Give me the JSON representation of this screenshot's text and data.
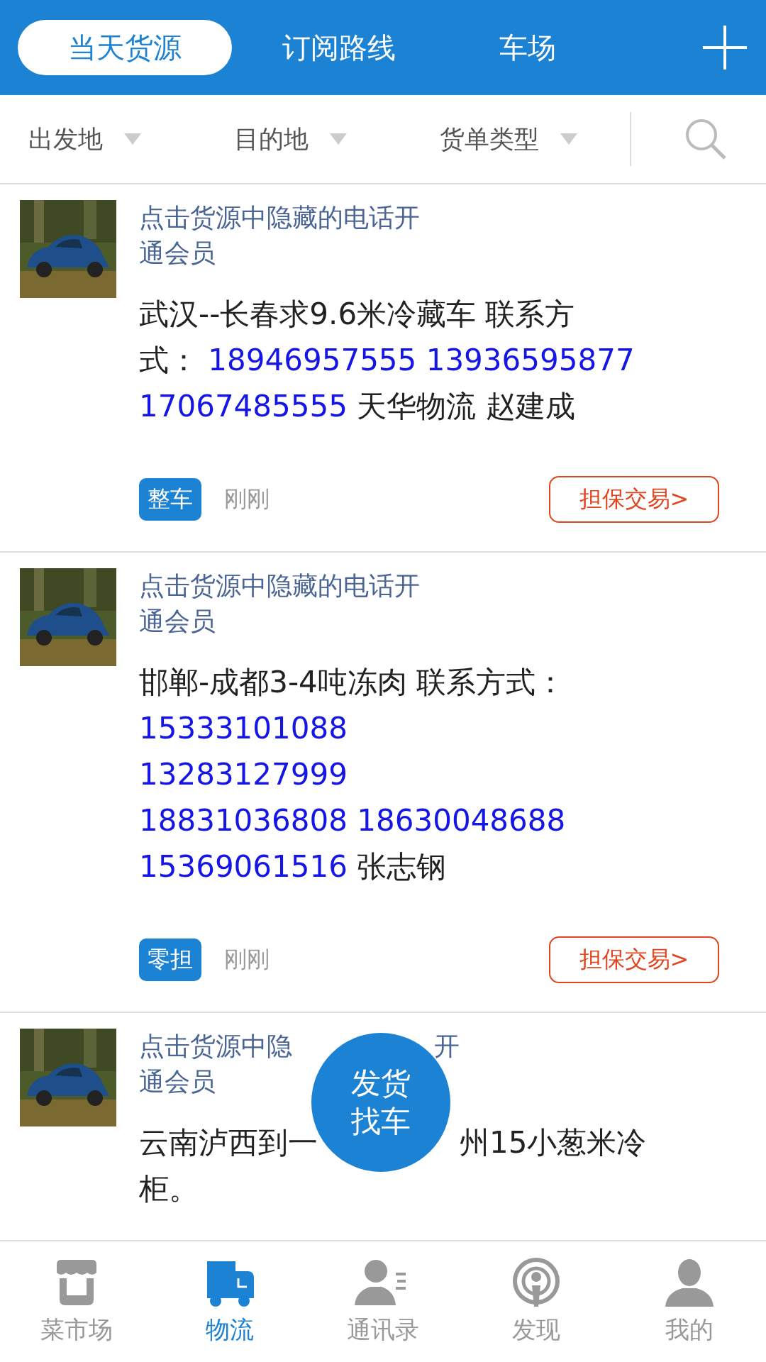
{
  "header": {
    "tabs": [
      {
        "label": "当天货源",
        "selected": true
      },
      {
        "label": "订阅路线",
        "selected": false
      },
      {
        "label": "车场",
        "selected": false
      }
    ]
  },
  "filters": [
    {
      "label": "出发地"
    },
    {
      "label": "目的地"
    },
    {
      "label": "货单类型"
    }
  ],
  "listings": [
    {
      "thumbnail": {
        "kind": "picture"
      },
      "hint_lines": [
        [
          {
            "text": "点击货源中隐藏的电话开"
          }
        ],
        [
          {
            "text": "通会员"
          }
        ]
      ],
      "description_lines": [
        [
          {
            "kind": "plain",
            "text": "武汉--长春求9.6米冷藏车 联系方"
          }
        ],
        [
          {
            "kind": "plain",
            "text": "式："
          },
          {
            "kind": "phone",
            "text": "18946957555"
          },
          {
            "kind": "phone",
            "text": "13936595877"
          }
        ],
        [
          {
            "kind": "phone",
            "text": "17067485555"
          },
          {
            "kind": "plain",
            "text": "天华物流 赵建成"
          }
        ]
      ],
      "tag": "整车",
      "time": "刚刚",
      "action": "担保交易>"
    },
    {
      "thumbnail": {
        "kind": "picture"
      },
      "hint_lines": [
        [
          {
            "text": "点击货源中隐藏的电话开"
          }
        ],
        [
          {
            "text": "通会员"
          }
        ]
      ],
      "description_lines": [
        [
          {
            "kind": "plain",
            "text": "邯郸-成都3-4吨冻肉 联系方式："
          }
        ],
        [
          {
            "kind": "phone",
            "text": "15333101088"
          }
        ],
        [
          {
            "kind": "phone",
            "text": "13283127999"
          }
        ],
        [
          {
            "kind": "phone",
            "text": "18831036808"
          },
          {
            "kind": "phone",
            "text": "18630048688"
          }
        ],
        [
          {
            "kind": "phone",
            "text": "15369061516"
          },
          {
            "kind": "plain",
            "text": "张志钢"
          }
        ]
      ],
      "tag": "零担",
      "time": "刚刚",
      "action": "担保交易>"
    },
    {
      "thumbnail": {
        "kind": "picture"
      },
      "hint_lines": [
        [
          {
            "text": "点击货源中隐",
            "covered_after": true
          },
          {
            "text": "开"
          }
        ],
        [
          {
            "text": "通会员"
          }
        ]
      ],
      "description_lines": [
        [
          {
            "kind": "plain",
            "text": "云南泸西到一",
            "covered_after": true
          },
          {
            "kind": "plain",
            "text": "州15小葱米冷"
          }
        ],
        [
          {
            "kind": "plain",
            "text": "柜。"
          }
        ]
      ]
    }
  ],
  "fab": {
    "lines": [
      "发货",
      "找车"
    ]
  },
  "bottom_nav": [
    {
      "label": "菜市场",
      "kind": "store",
      "selected": false
    },
    {
      "label": "物流",
      "kind": "truck",
      "selected": true
    },
    {
      "label": "通讯录",
      "kind": "contacts",
      "selected": false
    },
    {
      "label": "发现",
      "kind": "broadcast",
      "selected": false
    },
    {
      "label": "我的",
      "kind": "person",
      "selected": false
    }
  ]
}
